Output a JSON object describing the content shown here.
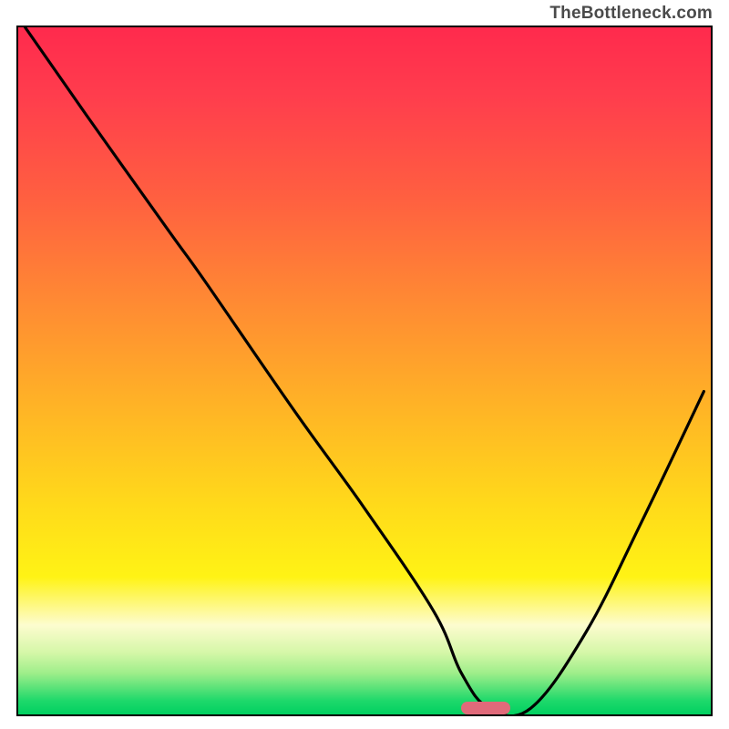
{
  "attribution": "TheBottleneck.com",
  "chart_data": {
    "type": "line",
    "title": "",
    "xlabel": "",
    "ylabel": "",
    "xlim": [
      0,
      100
    ],
    "ylim": [
      0,
      100
    ],
    "series": [
      {
        "name": "curve",
        "x": [
          1,
          10,
          22,
          27,
          40,
          50,
          60,
          64,
          68,
          74,
          82,
          90,
          99
        ],
        "y": [
          100,
          87,
          70,
          63,
          44,
          30,
          15,
          6,
          0.9,
          0.9,
          12,
          28,
          47
        ]
      }
    ],
    "marker": {
      "x_start": 64,
      "x_end": 71,
      "y": 0.9
    },
    "gradient_stops": [
      {
        "pct": 0,
        "color": "#ff2a4d"
      },
      {
        "pct": 10,
        "color": "#ff3d4d"
      },
      {
        "pct": 25,
        "color": "#ff6040"
      },
      {
        "pct": 40,
        "color": "#ff8a33"
      },
      {
        "pct": 55,
        "color": "#ffb326"
      },
      {
        "pct": 70,
        "color": "#ffdb1a"
      },
      {
        "pct": 80,
        "color": "#fff315"
      },
      {
        "pct": 87,
        "color": "#fdfccf"
      },
      {
        "pct": 91,
        "color": "#d5f7a8"
      },
      {
        "pct": 94,
        "color": "#9eee8a"
      },
      {
        "pct": 96,
        "color": "#5fe37a"
      },
      {
        "pct": 98,
        "color": "#1ed96b"
      },
      {
        "pct": 100,
        "color": "#00d060"
      }
    ]
  }
}
